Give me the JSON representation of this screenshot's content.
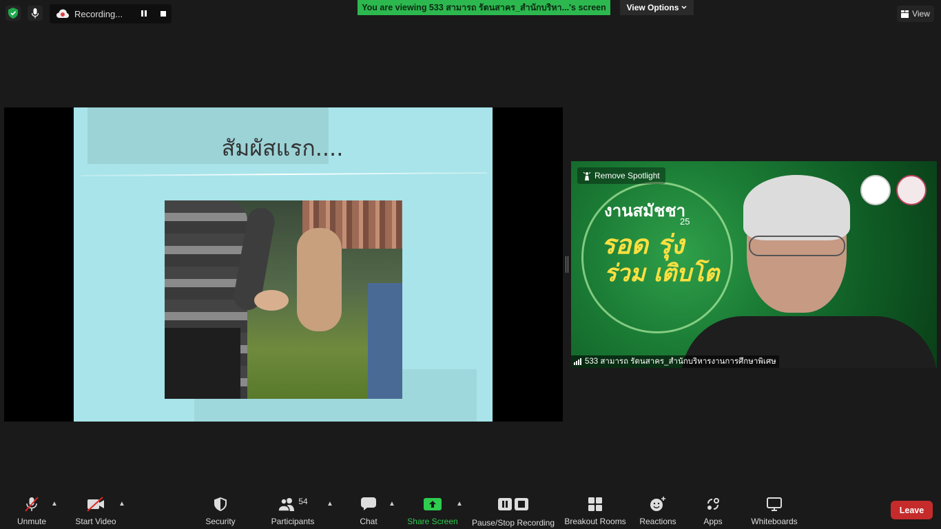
{
  "top_bar": {
    "recording_label": "Recording...",
    "viewing_banner": "You are viewing 533 สามารถ รัตนสาคร_สำนักบริหา...'s screen",
    "view_options_label": "View Options",
    "view_label": "View"
  },
  "slide": {
    "title": "สัมผัสแรก...."
  },
  "video": {
    "remove_spotlight_label": "Remove Spotlight",
    "participant_name": "533 สามารถ รัตนสาคร_สำนักบริหารงานการศึกษาพิเศษ",
    "bg_title": "งานสมัชชา",
    "bg_big1": "รอด รุ่ง",
    "bg_big2": "ร่วม เติบโต",
    "bg_number": "25"
  },
  "toolbar": {
    "unmute": "Unmute",
    "start_video": "Start Video",
    "security": "Security",
    "participants": "Participants",
    "participants_count": "54",
    "chat": "Chat",
    "share_screen": "Share Screen",
    "pause_stop_recording": "Pause/Stop Recording",
    "breakout_rooms": "Breakout Rooms",
    "reactions": "Reactions",
    "apps": "Apps",
    "whiteboards": "Whiteboards",
    "leave": "Leave"
  },
  "colors": {
    "banner_green": "#2db84f",
    "leave_red": "#c62b2b",
    "share_green": "#2ecc4f",
    "slide_bg": "#a8e4ea"
  }
}
